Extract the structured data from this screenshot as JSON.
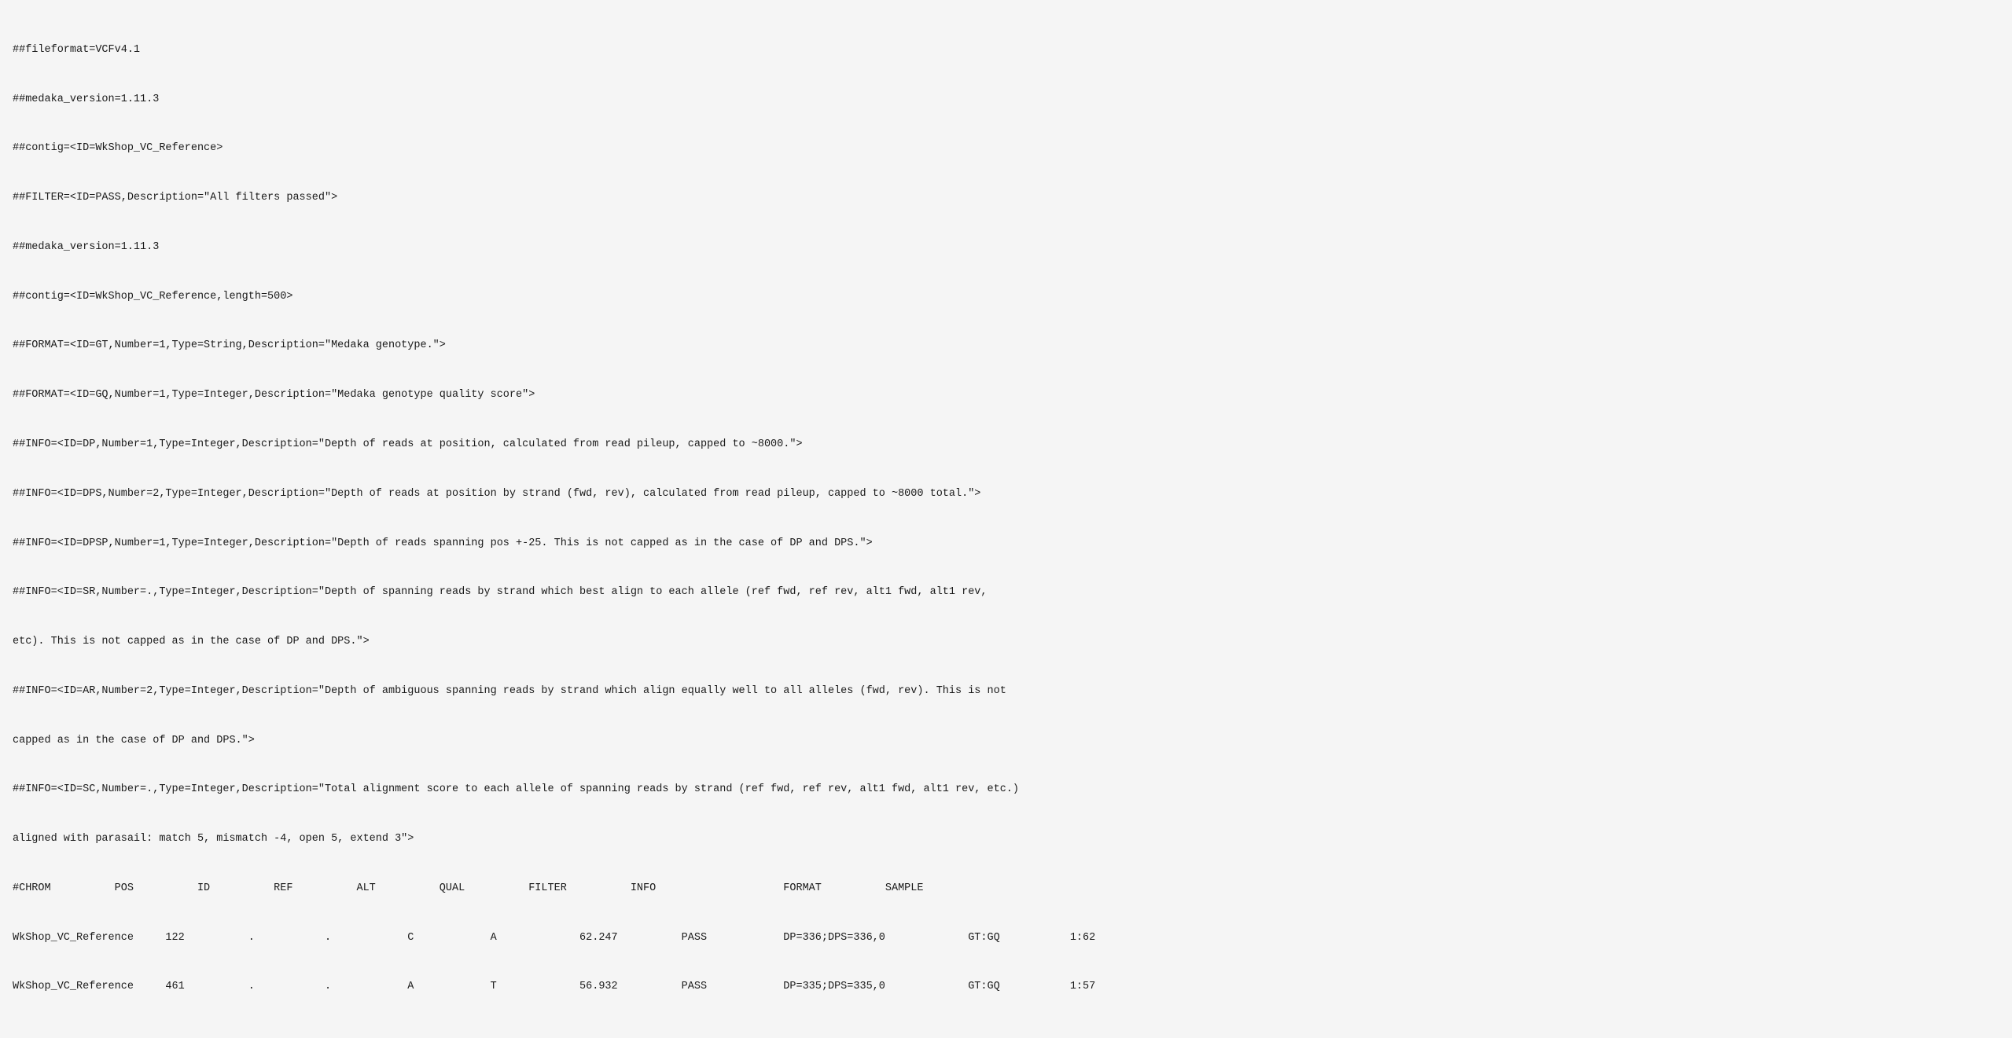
{
  "vcf": {
    "lines": [
      {
        "id": "line-1",
        "text": "##fileformat=VCFv4.1",
        "type": "header"
      },
      {
        "id": "line-2",
        "text": "##medaka_version=1.11.3",
        "type": "header"
      },
      {
        "id": "line-3",
        "text": "##contig=<ID=WkShop_VC_Reference>",
        "type": "header"
      },
      {
        "id": "line-4",
        "text": "##FILTER=<ID=PASS,Description=\"All filters passed\">",
        "type": "header"
      },
      {
        "id": "line-5",
        "text": "##medaka_version=1.11.3",
        "type": "header"
      },
      {
        "id": "line-6",
        "text": "##contig=<ID=WkShop_VC_Reference,length=500>",
        "type": "header"
      },
      {
        "id": "line-7",
        "text": "##FORMAT=<ID=GT,Number=1,Type=String,Description=\"Medaka genotype.\">",
        "type": "header"
      },
      {
        "id": "line-8",
        "text": "##FORMAT=<ID=GQ,Number=1,Type=Integer,Description=\"Medaka genotype quality score\">",
        "type": "header"
      },
      {
        "id": "line-9",
        "text": "##INFO=<ID=DP,Number=1,Type=Integer,Description=\"Depth of reads at position, calculated from read pileup, capped to ~8000.\">",
        "type": "header"
      },
      {
        "id": "line-10",
        "text": "##INFO=<ID=DPS,Number=2,Type=Integer,Description=\"Depth of reads at position by strand (fwd, rev), calculated from read pileup, capped to ~8000 total.\">",
        "type": "header"
      },
      {
        "id": "line-11",
        "text": "##INFO=<ID=DPSP,Number=1,Type=Integer,Description=\"Depth of reads spanning pos +-25. This is not capped as in the case of DP and DPS.\">",
        "type": "header"
      },
      {
        "id": "line-12",
        "text": "##INFO=<ID=SR,Number=.,Type=Integer,Description=\"Depth of spanning reads by strand which best align to each allele (ref fwd, ref rev, alt1 fwd, alt1 rev,",
        "type": "header"
      },
      {
        "id": "line-12b",
        "text": "etc). This is not capped as in the case of DP and DPS.\">",
        "type": "header"
      },
      {
        "id": "line-13",
        "text": "##INFO=<ID=AR,Number=2,Type=Integer,Description=\"Depth of ambiguous spanning reads by strand which align equally well to all alleles (fwd, rev). This is not",
        "type": "header"
      },
      {
        "id": "line-13b",
        "text": "capped as in the case of DP and DPS.\">",
        "type": "header"
      },
      {
        "id": "line-14",
        "text": "##INFO=<ID=SC,Number=.,Type=Integer,Description=\"Total alignment score to each allele of spanning reads by strand (ref fwd, ref rev, alt1 fwd, alt1 rev, etc.)",
        "type": "header"
      },
      {
        "id": "line-14b",
        "text": "aligned with parasail: match 5, mismatch -4, open 5, extend 3\">",
        "type": "header"
      },
      {
        "id": "line-15",
        "text": "#CHROM\t\tPOS\t\tID\t\tREF\t\tALT\t\tQUAL\t\tFILTER\t\tINFO\t\t\tFORMAT\t\tSAMPLE",
        "type": "chrom"
      },
      {
        "id": "line-16",
        "text": "WkShop_VC_Reference\t\t122\t\t.\t\t.\t\tC\t\tA\t\t62.247\t\tPASS\t\tDP=336;DPS=336,0\t\t\tGT:GQ\t\t1:62",
        "type": "data"
      },
      {
        "id": "line-17",
        "text": "WkShop_VC_Reference\t\t461\t\t.\t\t.\t\tA\t\tT\t\t56.932\t\tPASS\t\tDP=335;DPS=335,0\t\t\tGT:GQ\t\t1:57",
        "type": "data"
      }
    ],
    "chrom_line": "#CHROM          POS             ID              REF             ALT             QUAL            FILTER          INFO                        FORMAT          SAMPLE",
    "data_rows": [
      {
        "chrom": "WkShop_VC_Reference",
        "pos": "122",
        "id": ".",
        "ref": ".",
        "alt": "C",
        "qual": "A",
        "filter": "62.247",
        "info": "PASS",
        "info2": "DP=336;DPS=336,0",
        "format": "GT:GQ",
        "sample": "1:62"
      },
      {
        "chrom": "WkShop_VC_Reference",
        "pos": "461",
        "id": ".",
        "ref": ".",
        "alt": "A",
        "qual": "T",
        "filter": "56.932",
        "info": "PASS",
        "info2": "DP=335;DPS=335,0",
        "format": "GT:GQ",
        "sample": "1:57"
      }
    ]
  }
}
